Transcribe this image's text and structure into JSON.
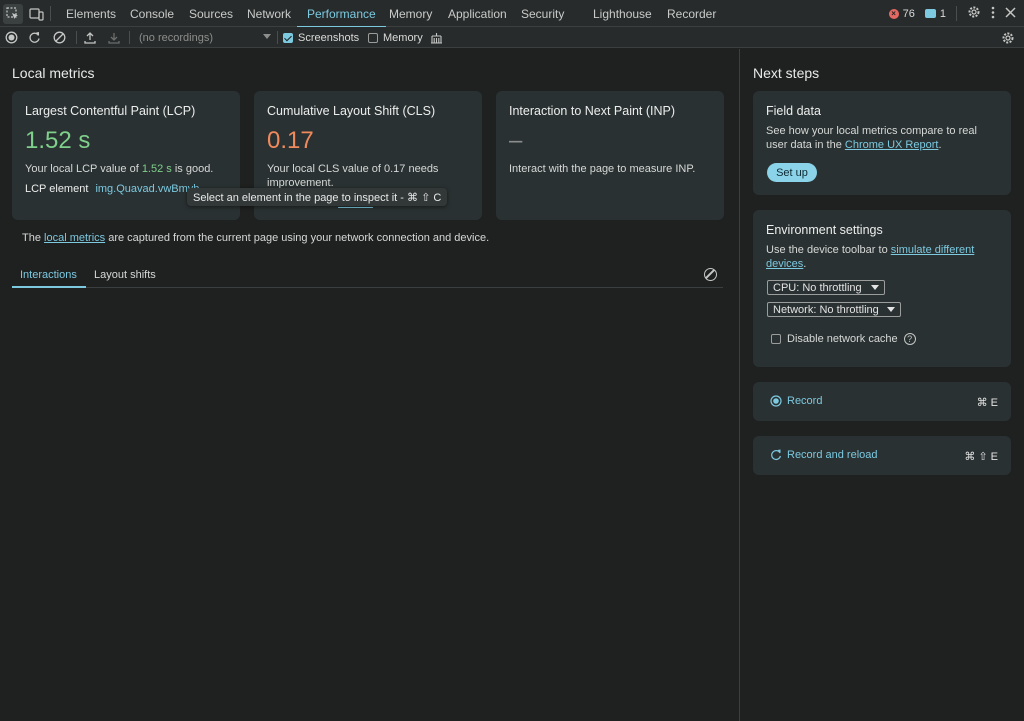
{
  "tabs": {
    "items": [
      "Elements",
      "Console",
      "Sources",
      "Network",
      "Performance",
      "Memory",
      "Application",
      "Security",
      "Lighthouse",
      "Recorder"
    ],
    "active": "Performance",
    "error_count": "76",
    "message_count": "1"
  },
  "toolbar": {
    "recordings_placeholder": "(no recordings)",
    "screenshots_label": "Screenshots",
    "screenshots_checked": true,
    "memory_label": "Memory",
    "memory_checked": false
  },
  "local_metrics": {
    "heading": "Local metrics",
    "lcp": {
      "title": "Largest Contentful Paint (LCP)",
      "value": "1.52 s",
      "desc_prefix": "Your local LCP value of ",
      "desc_value": "1.52 s",
      "desc_suffix": " is good.",
      "element_label": "LCP element",
      "element_value": "img.Quavad.vwBmvb"
    },
    "cls": {
      "title": "Cumulative Layout Shift (CLS)",
      "value": "0.17",
      "desc": "Your local CLS value of 0.17 needs improvement.",
      "worst_label": "Worst cluster",
      "worst_value": "7 shifts"
    },
    "inp": {
      "title": "Interaction to Next Paint (INP)",
      "value": "–",
      "desc": "Interact with the page to measure INP."
    },
    "tooltip": "Select an element in the page to inspect it - ⌘ ⇧ C",
    "note_prefix": "The ",
    "note_link": "local metrics",
    "note_suffix": " are captured from the current page using your network connection and device.",
    "subtabs": [
      "Interactions",
      "Layout shifts"
    ]
  },
  "next_steps": {
    "heading": "Next steps",
    "field_data": {
      "title": "Field data",
      "desc_prefix": "See how your local metrics compare to real user data in the ",
      "desc_link": "Chrome UX Report",
      "desc_suffix": ".",
      "button": "Set up"
    },
    "env": {
      "title": "Environment settings",
      "desc_prefix": "Use the device toolbar to ",
      "desc_link": "simulate different devices",
      "desc_suffix": ".",
      "cpu": "CPU: No throttling",
      "network": "Network: No throttling",
      "cache_label": "Disable network cache",
      "help": "?"
    },
    "record": {
      "label": "Record",
      "shortcut": "⌘ E"
    },
    "record_reload": {
      "label": "Record and reload",
      "shortcut": "⌘ ⇧ E"
    }
  }
}
